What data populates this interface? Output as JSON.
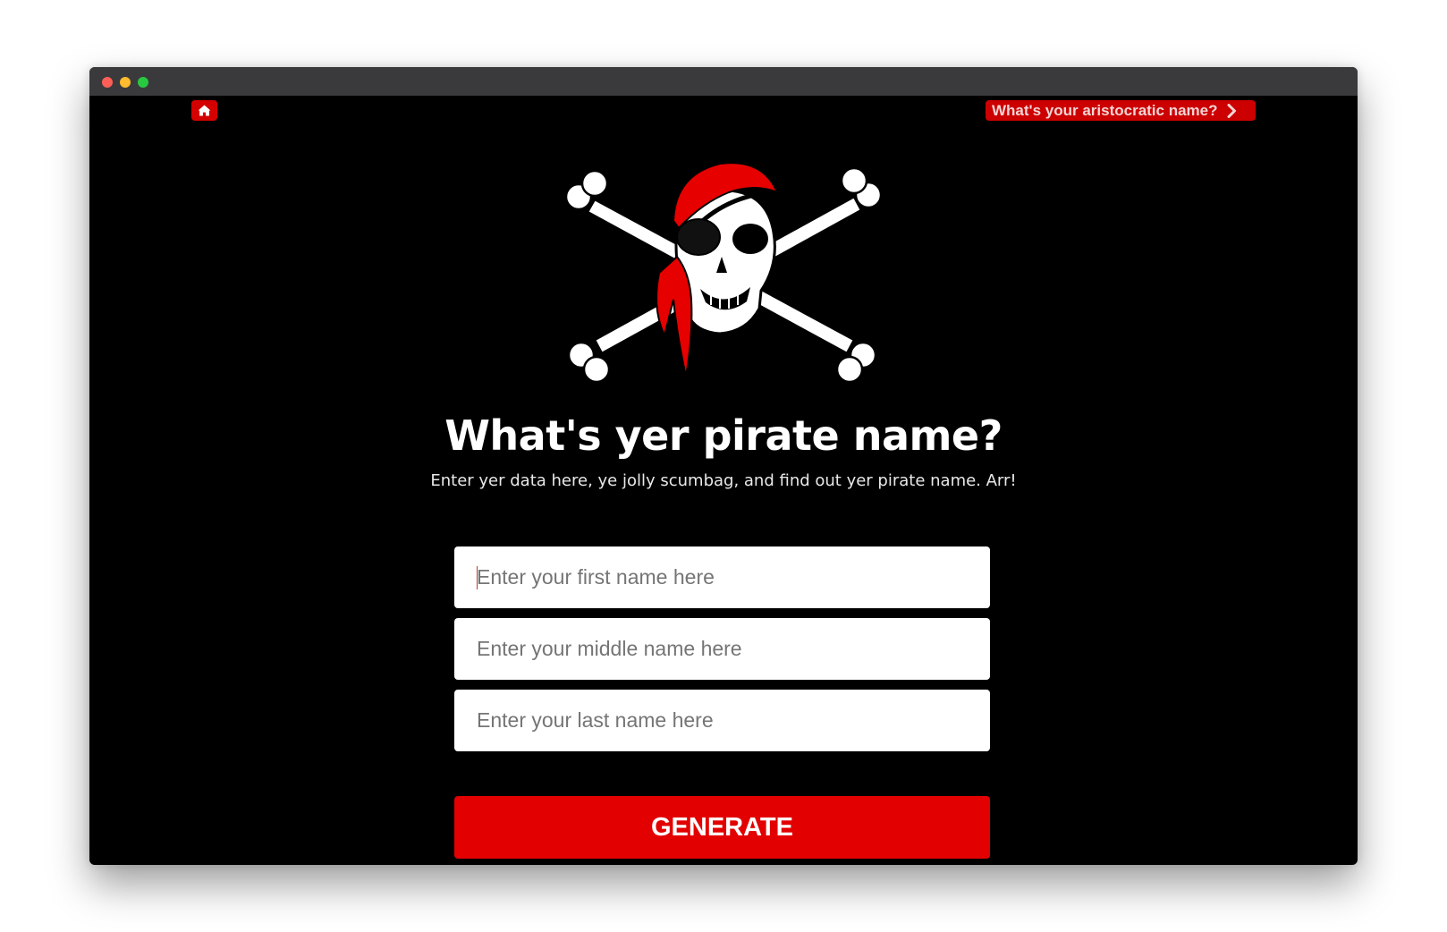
{
  "nav": {
    "home_icon": "home-icon",
    "aristocratic_label": "What's your aristocratic name?",
    "aristocratic_icon": "chevron-right-icon"
  },
  "hero": {
    "logo_icon": "skull-crossbones-icon",
    "title": "What's yer pirate name?",
    "subtitle": "Enter yer data here, ye jolly scumbag, and find out yer pirate name. Arr!"
  },
  "form": {
    "first_name_placeholder": "Enter your first name here",
    "middle_name_placeholder": "Enter your middle name here",
    "last_name_placeholder": "Enter your last name here",
    "first_name_value": "",
    "middle_name_value": "",
    "last_name_value": "",
    "submit_label": "GENERATE"
  },
  "colors": {
    "accent": "#e20000",
    "background": "#000000",
    "titlebar": "#3a3a3c"
  }
}
